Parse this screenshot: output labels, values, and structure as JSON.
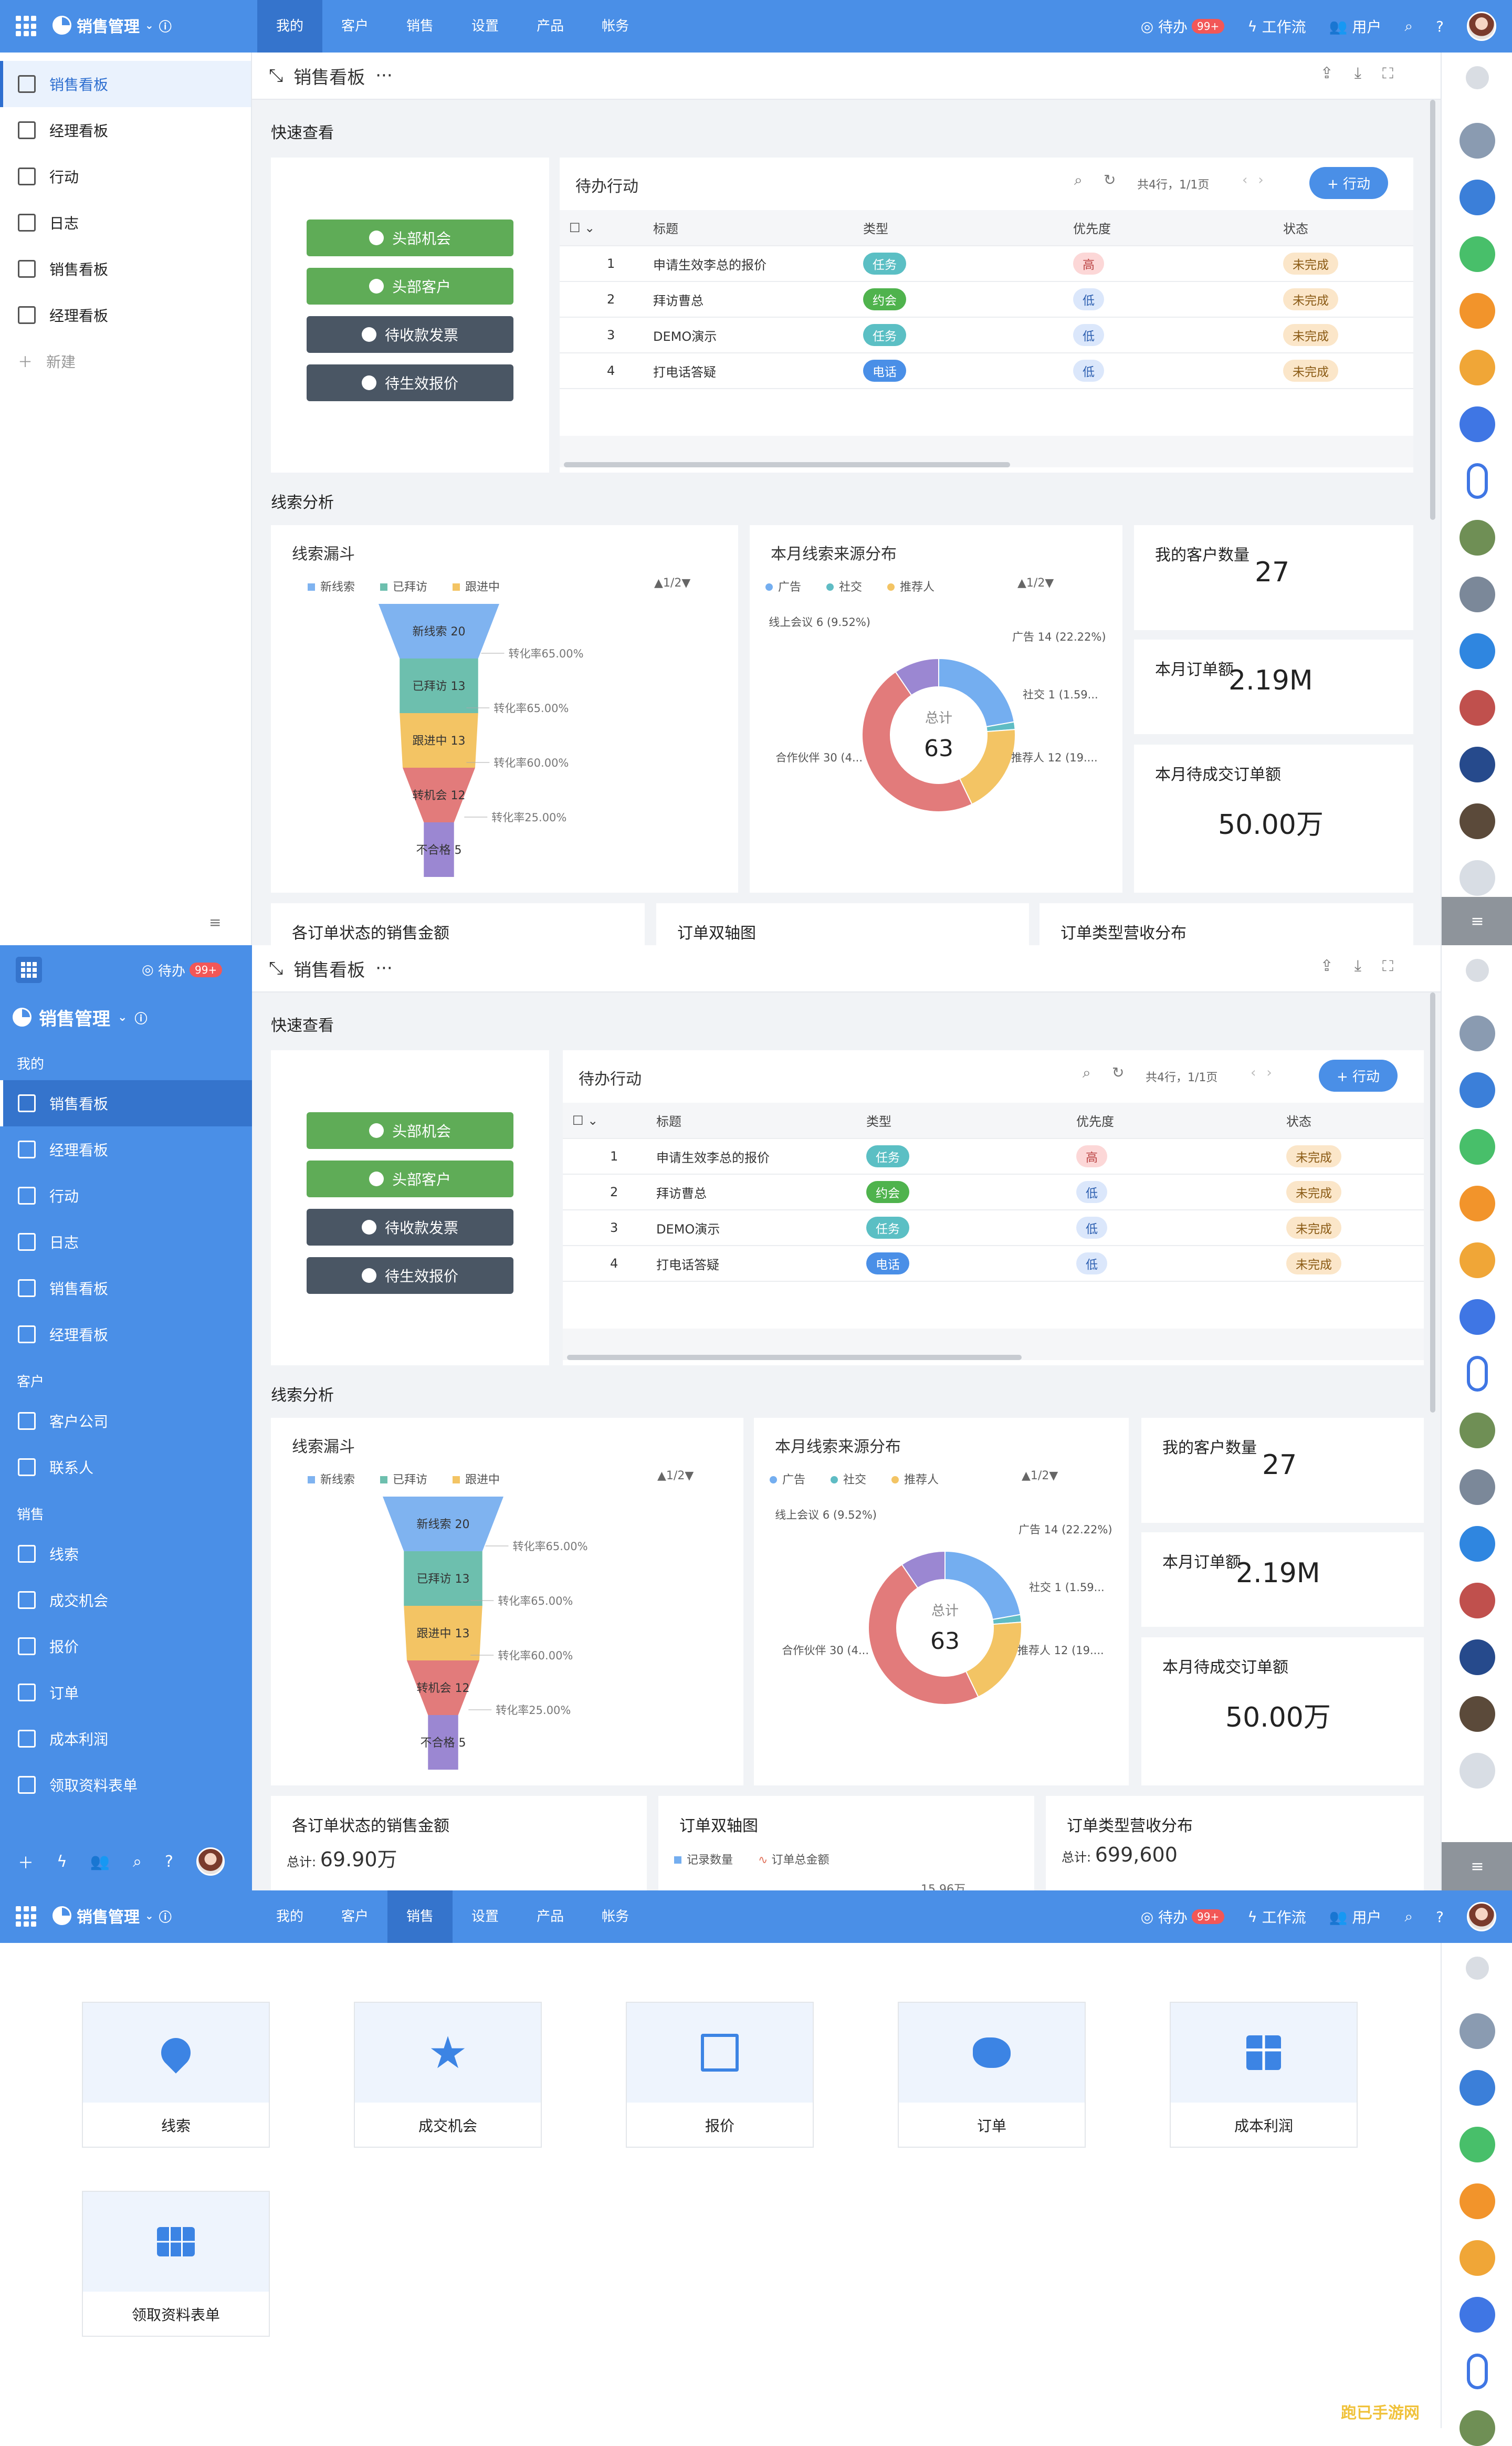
{
  "app": {
    "name": "销售管理",
    "pending_label": "待办",
    "pending_badge": "99+",
    "workflow": "工作流",
    "users": "用户"
  },
  "nav": [
    "我的",
    "客户",
    "销售",
    "设置",
    "产品",
    "帐务"
  ],
  "sidebar_top": [
    "销售看板",
    "经理看板",
    "行动",
    "日志",
    "销售看板",
    "经理看板"
  ],
  "new_label": "新建",
  "sidebar_mid": {
    "group_mine": "我的",
    "mine": [
      "销售看板",
      "经理看板",
      "行动",
      "日志",
      "销售看板",
      "经理看板"
    ],
    "group_cust": "客户",
    "cust": [
      "客户公司",
      "联系人"
    ],
    "group_sales": "销售",
    "sales": [
      "线索",
      "成交机会",
      "报价",
      "订单",
      "成本利润",
      "领取资料表单"
    ]
  },
  "dashboard": {
    "title": "销售看板",
    "more": "···",
    "quick_title": "快速查看",
    "quick_buttons": [
      "头部机会",
      "头部客户",
      "待收款发票",
      "待生效报价"
    ],
    "todo": {
      "title": "待办行动",
      "pager": "共4行，1/1页",
      "add": "+ 行动",
      "headers": [
        "标题",
        "类型",
        "优先度",
        "状态"
      ],
      "rows": [
        {
          "n": "1",
          "title": "申请生效李总的报价",
          "type": "任务",
          "prio": "高",
          "status": "未完成"
        },
        {
          "n": "2",
          "title": "拜访曹总",
          "type": "约会",
          "prio": "低",
          "status": "未完成"
        },
        {
          "n": "3",
          "title": "DEMO演示",
          "type": "任务",
          "prio": "低",
          "status": "未完成"
        },
        {
          "n": "4",
          "title": "打电话答疑",
          "type": "电话",
          "prio": "低",
          "status": "未完成"
        }
      ]
    },
    "analysis_title": "线索分析",
    "funnel": {
      "title": "线索漏斗",
      "legend": [
        "新线索",
        "已拜访",
        "跟进中"
      ],
      "page": "1/2",
      "stages": [
        "新线索 20",
        "已拜访 13",
        "跟进中 13",
        "转机会 12",
        "不合格 5"
      ],
      "rates": [
        "转化率65.00%",
        "转化率65.00%",
        "转化率60.00%",
        "转化率25.00%"
      ],
      "colors": [
        "#7fb3f0",
        "#6dbfae",
        "#f3c464",
        "#e27b7b",
        "#9b87d2"
      ]
    },
    "source": {
      "title": "本月线索来源分布",
      "legend": [
        "广告",
        "社交",
        "推荐人"
      ],
      "page": "1/2",
      "center_label": "总计",
      "center_value": "63",
      "labels": [
        "广告  14 (22.22%)",
        "社交  1 (1.59...",
        "推荐人  12 (19....",
        "合作伙伴  30 (4...",
        "线上会议  6 (9.52%)"
      ]
    },
    "kpi": [
      {
        "title": "我的客户数量",
        "value": "27"
      },
      {
        "title": "本月订单额",
        "value": "2.19M"
      },
      {
        "title": "本月待成交订单额",
        "value": "50.00万"
      }
    ],
    "bottom": [
      {
        "title": "各订单状态的销售金额",
        "total_label": "总计:",
        "total": "69.90万"
      },
      {
        "title": "订单双轴图",
        "legend": [
          "记录数量",
          "订单总金额"
        ],
        "peek": "15.96万"
      },
      {
        "title": "订单类型营收分布",
        "total_label": "总计:",
        "total": "699,600"
      }
    ]
  },
  "chart_data": [
    {
      "type": "funnel",
      "title": "线索漏斗",
      "categories": [
        "新线索",
        "已拜访",
        "跟进中",
        "转机会",
        "不合格"
      ],
      "values": [
        20,
        13,
        13,
        12,
        5
      ],
      "rates": [
        "65.00%",
        "65.00%",
        "60.00%",
        "25.00%"
      ]
    },
    {
      "type": "pie",
      "title": "本月线索来源分布",
      "categories": [
        "广告",
        "社交",
        "推荐人",
        "合作伙伴",
        "线上会议"
      ],
      "values": [
        14,
        1,
        12,
        30,
        6
      ],
      "colors": [
        "#74aef0",
        "#5fbcc4",
        "#f3c464",
        "#e27b7b",
        "#9b87d2"
      ],
      "total": 63
    }
  ],
  "sales_tiles": [
    "线索",
    "成交机会",
    "报价",
    "订单",
    "成本利润",
    "领取资料表单"
  ],
  "watermark": "跑已手游网"
}
